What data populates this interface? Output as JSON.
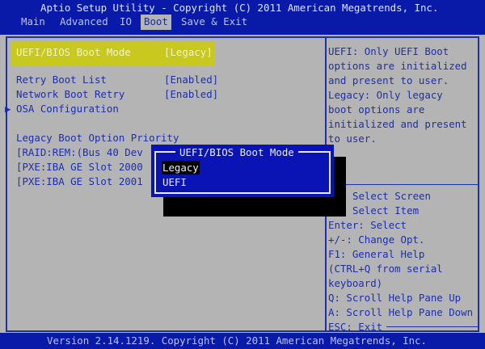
{
  "header": {
    "title": "Aptio Setup Utility - Copyright (C) 2011 American Megatrends, Inc.",
    "tabs": [
      {
        "label": "Main"
      },
      {
        "label": "Advanced"
      },
      {
        "label": "IO"
      },
      {
        "label": "Boot"
      },
      {
        "label": "Save & Exit"
      }
    ],
    "active_tab": "Boot"
  },
  "settings": {
    "boot_mode": {
      "label": "UEFI/BIOS Boot Mode",
      "value": "[Legacy]"
    },
    "retry": {
      "label": "Retry Boot List",
      "value": "[Enabled]"
    },
    "network_retry": {
      "label": "Network Boot Retry",
      "value": "[Enabled]"
    },
    "osa": {
      "label": "OSA Configuration",
      "arrow": "▶"
    },
    "priority_heading": "Legacy Boot Option Priority",
    "priority": [
      "[RAID:REM:(Bus 40 Dev",
      "[PXE:IBA GE Slot 2000",
      "[PXE:IBA GE Slot 2001"
    ]
  },
  "help": {
    "description": [
      "UEFI: Only UEFI Boot",
      "options are initialized",
      "and present to user.",
      "Legacy: Only legacy",
      "boot options are",
      "initialized and present",
      "to user."
    ],
    "keys": [
      "Select Screen",
      "Select Item",
      "Enter: Select",
      "+/-: Change Opt.",
      "F1: General Help",
      "(CTRL+Q from serial",
      "keyboard)",
      "Q: Scroll Help Pane Up",
      "A: Scroll Help Pane Down",
      "ESC: Exit"
    ]
  },
  "popup": {
    "title": "UEFI/BIOS Boot Mode",
    "options": [
      "Legacy",
      "UEFI"
    ],
    "selected": "Legacy"
  },
  "footer": "Version 2.14.1219. Copyright (C) 2011 American Megatrends, Inc."
}
